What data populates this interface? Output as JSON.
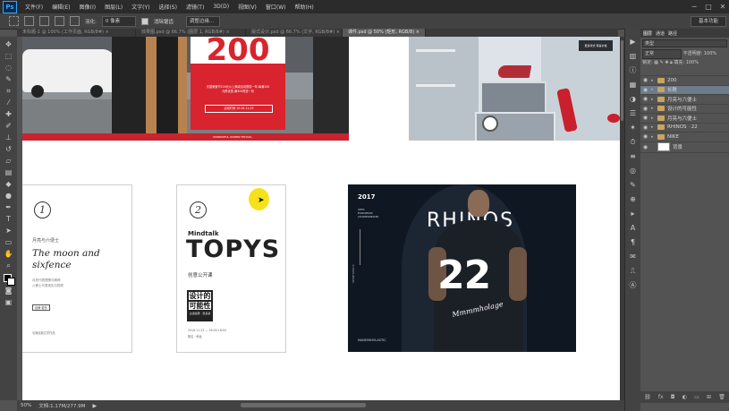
{
  "app": {
    "logo": "Ps"
  },
  "menu": [
    "文件(F)",
    "编辑(E)",
    "图像(I)",
    "图层(L)",
    "文字(Y)",
    "选择(S)",
    "滤镜(T)",
    "3D(D)",
    "视图(V)",
    "窗口(W)",
    "帮助(H)"
  ],
  "window_controls": [
    "─",
    "□",
    "✕"
  ],
  "options": {
    "feather_value": "0 像素",
    "anti_alias": "消除锯齿",
    "style": "调整边缘...",
    "workspace": "基本功能"
  },
  "tabs": [
    {
      "label": "未标题-1 @ 100% (工作页面, RGB/8#) ×"
    },
    {
      "label": "效果图.psd @ 66.7% (图层 1, RGB/8#) ×"
    },
    {
      "label": "版式设计.psd @ 66.7% (文字, RGB/8#) ×"
    },
    {
      "label": "课件.psd @ 50% (矩形, RGB/8) ×",
      "active": true
    }
  ],
  "status": {
    "zoom": "50%",
    "doc": "文档:1.17M/277.9M"
  },
  "layers_panel": {
    "tabs": [
      "图层",
      "通道",
      "路径"
    ],
    "filter": "类型",
    "mode": "正常",
    "opacity_label": "不透明度:",
    "opacity": "100%",
    "lock_label": "锁定:",
    "fill_label": "填充:",
    "fill": "100%",
    "layers": [
      {
        "name": "200",
        "type": "folder",
        "selected": false
      },
      {
        "name": "长靴",
        "type": "folder",
        "selected": true
      },
      {
        "name": "月亮与六便士",
        "type": "folder",
        "selected": false
      },
      {
        "name": "设计的可能性",
        "type": "folder",
        "selected": false
      },
      {
        "name": "月亮与六便士",
        "type": "folder",
        "selected": false
      },
      {
        "name": "RHINOS · 22",
        "type": "folder",
        "selected": false
      },
      {
        "name": "NIKE",
        "type": "folder",
        "selected": false
      },
      {
        "name": "背景",
        "type": "layer",
        "selected": false
      }
    ]
  },
  "artboard": {
    "banner1": {
      "number": "200",
      "line1": "天猫美食节100元以上满减活动提前一年,每满200",
      "line2": "元再优惠,满300再送一份",
      "cta": "活动时间 10.28-11.03",
      "footer": "WONDERFUL WOMEN FESTIVAL"
    },
    "banner2": {
      "badge": "更多款式 惊喜价格"
    },
    "card1": {
      "num": "1",
      "cn": "月亮与六便士",
      "en1": "The moon and",
      "en2": "sixfence",
      "desc1": "月亮代表理想与精神",
      "desc2": "六便士代表现实与物质",
      "tag": "品牌  更多",
      "foot": "毛姆经典文学作品"
    },
    "card2": {
      "num": "2",
      "brand": "Mindtalk",
      "title": "TOPYS",
      "sub": "创意公开课",
      "box1": "设计的",
      "box2": "可能性",
      "box3": "主讲嘉宾 · 张某某",
      "date1": "2016.11.23 — 16:00-18:00",
      "date2": "报名 · 地址"
    },
    "poster": {
      "year": "2017",
      "uefa1": "UEFA",
      "uefa2": "EUROPEAN",
      "uefa3": "CHAMPIONSHIP",
      "title": "RHINOS",
      "number": "22",
      "script": "Mmmmholage",
      "side": "SPORTSHOLIC",
      "foot": "MADEINHOLASTIC"
    }
  },
  "colors": {
    "accent_red": "#d9232e",
    "poster_bg": "#0f1822",
    "cursor_yellow": "#f5e21a"
  }
}
